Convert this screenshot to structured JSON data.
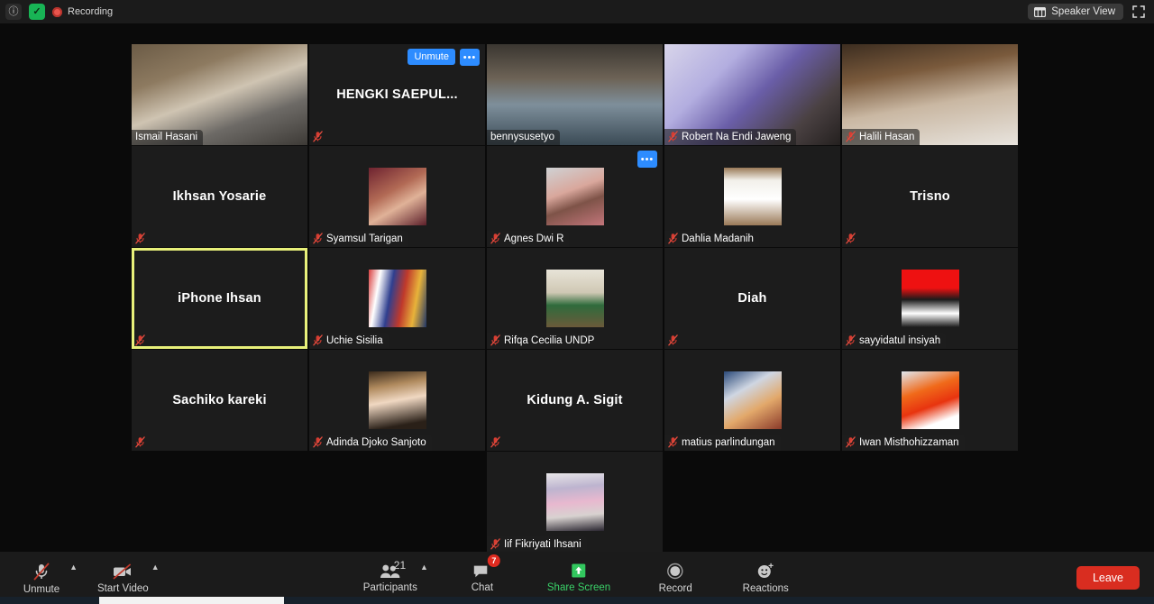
{
  "topbar": {
    "info_icon": "info-icon",
    "shield_icon": "encryption-shield-icon",
    "recording_label": "Recording",
    "speaker_view_label": "Speaker View",
    "speaker_view_icon": "layout-icon",
    "fullscreen_icon": "fullscreen-icon"
  },
  "grid": {
    "columns": 5,
    "rows": 5,
    "selected_tile": "iPhone Ihsan",
    "selected_border_color": "#e8f07a",
    "unmute_chip_label": "Unmute",
    "dots_label": "•••",
    "tiles": [
      {
        "name": "Ismail Hasani",
        "display": "video",
        "muted": false,
        "label_pos": "bottom",
        "row": 0,
        "col": 0
      },
      {
        "name": "HENGKI  SAEPUL...",
        "display": "name",
        "muted": true,
        "label_pos": "center",
        "row": 0,
        "col": 1,
        "unmute_chip": true,
        "dots_chip": true
      },
      {
        "name": "bennysusetyo",
        "display": "video",
        "muted": false,
        "label_pos": "bottom",
        "row": 0,
        "col": 2
      },
      {
        "name": "Robert Na Endi Jaweng",
        "display": "video",
        "muted": true,
        "label_pos": "bottom",
        "row": 0,
        "col": 3
      },
      {
        "name": "Halili Hasan",
        "display": "video",
        "muted": true,
        "label_pos": "bottom",
        "row": 0,
        "col": 4
      },
      {
        "name": "Ikhsan Yosarie",
        "display": "name",
        "muted": true,
        "label_pos": "center",
        "row": 1,
        "col": 0
      },
      {
        "name": "Syamsul Tarigan",
        "display": "avatar",
        "muted": true,
        "label_pos": "bottom",
        "row": 1,
        "col": 1
      },
      {
        "name": "Agnes Dwi R",
        "display": "avatar",
        "muted": true,
        "label_pos": "bottom",
        "row": 1,
        "col": 2,
        "dots_chip": true
      },
      {
        "name": "Dahlia Madanih",
        "display": "avatar",
        "muted": true,
        "label_pos": "bottom",
        "row": 1,
        "col": 3
      },
      {
        "name": "Trisno",
        "display": "name",
        "muted": true,
        "label_pos": "center",
        "row": 1,
        "col": 4
      },
      {
        "name": "iPhone Ihsan",
        "display": "name",
        "muted": true,
        "label_pos": "center",
        "row": 2,
        "col": 0,
        "selected": true
      },
      {
        "name": "Uchie Sisilia",
        "display": "avatar",
        "muted": true,
        "label_pos": "bottom",
        "row": 2,
        "col": 1
      },
      {
        "name": "Rifqa Cecilia UNDP",
        "display": "avatar",
        "muted": true,
        "label_pos": "bottom",
        "row": 2,
        "col": 2
      },
      {
        "name": "Diah",
        "display": "name",
        "muted": true,
        "label_pos": "center",
        "row": 2,
        "col": 3
      },
      {
        "name": "sayyidatul insiyah",
        "display": "avatar",
        "muted": true,
        "label_pos": "bottom",
        "row": 2,
        "col": 4
      },
      {
        "name": "Sachiko kareki",
        "display": "name",
        "muted": true,
        "label_pos": "center",
        "row": 3,
        "col": 0
      },
      {
        "name": "Adinda Djoko Sanjoto",
        "display": "avatar",
        "muted": true,
        "label_pos": "bottom",
        "row": 3,
        "col": 1
      },
      {
        "name": "Kidung A. Sigit",
        "display": "name",
        "muted": true,
        "label_pos": "center",
        "row": 3,
        "col": 2
      },
      {
        "name": "matius parlindungan",
        "display": "avatar",
        "muted": true,
        "label_pos": "bottom",
        "row": 3,
        "col": 3
      },
      {
        "name": "Iwan Misthohizzaman",
        "display": "avatar",
        "muted": true,
        "label_pos": "bottom",
        "row": 3,
        "col": 4
      },
      {
        "name": "Iif Fikriyati Ihsani",
        "display": "avatar",
        "muted": true,
        "label_pos": "bottom",
        "row": 4,
        "col": 2
      }
    ]
  },
  "toolbar": {
    "unmute_label": "Unmute",
    "unmute_icon": "mic-muted-icon",
    "start_video_label": "Start Video",
    "start_video_icon": "camera-muted-icon",
    "participants_label": "Participants",
    "participants_icon": "people-icon",
    "participants_count": "21",
    "chat_label": "Chat",
    "chat_icon": "chat-bubble-icon",
    "chat_badge": "7",
    "share_screen_label": "Share Screen",
    "share_screen_icon": "share-screen-icon",
    "share_screen_color": "#3ad168",
    "record_label": "Record",
    "record_icon": "record-circle-icon",
    "reactions_label": "Reactions",
    "reactions_icon": "smiley-plus-icon",
    "leave_label": "Leave",
    "leave_color": "#d92d20"
  }
}
